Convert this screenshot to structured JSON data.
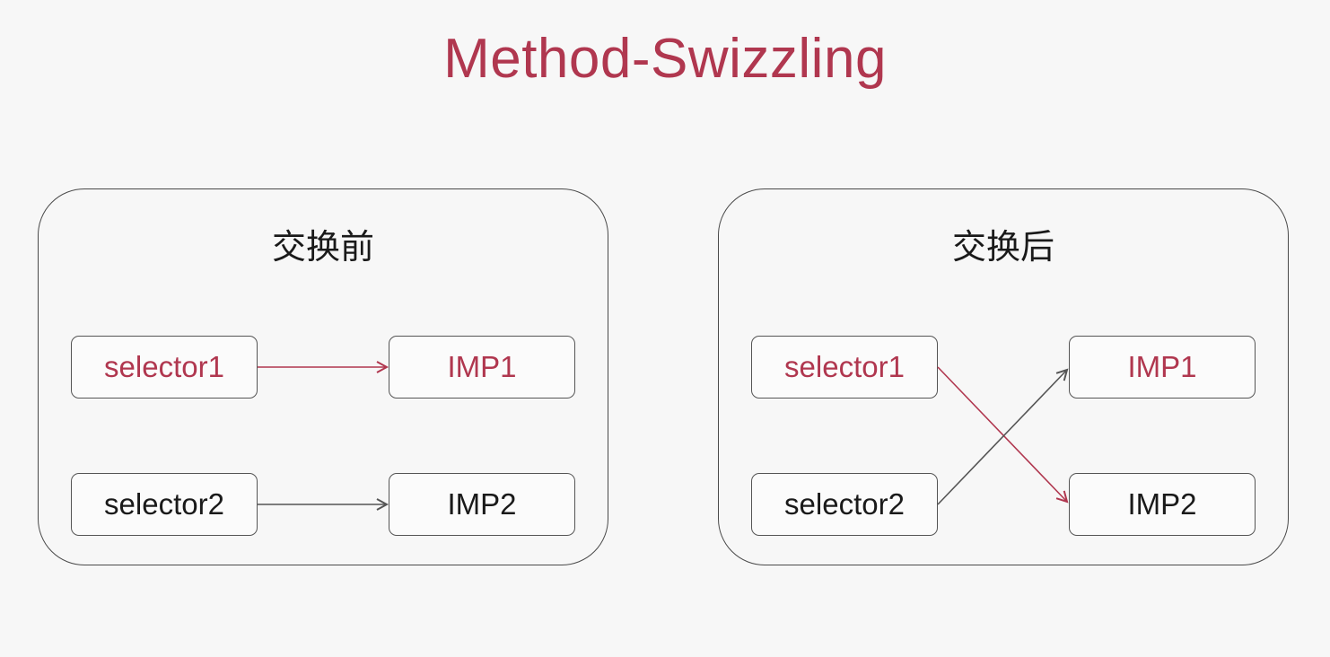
{
  "title": "Method-Swizzling",
  "colors": {
    "accent": "#b0374f",
    "dark": "#1a1a1a",
    "line_dark": "#555555"
  },
  "before": {
    "heading": "交换前",
    "selector1": "selector1",
    "selector2": "selector2",
    "imp1": "IMP1",
    "imp2": "IMP2",
    "links": [
      {
        "from": "selector1",
        "to": "IMP1"
      },
      {
        "from": "selector2",
        "to": "IMP2"
      }
    ]
  },
  "after": {
    "heading": "交换后",
    "selector1": "selector1",
    "selector2": "selector2",
    "imp1": "IMP1",
    "imp2": "IMP2",
    "links": [
      {
        "from": "selector1",
        "to": "IMP2"
      },
      {
        "from": "selector2",
        "to": "IMP1"
      }
    ]
  }
}
